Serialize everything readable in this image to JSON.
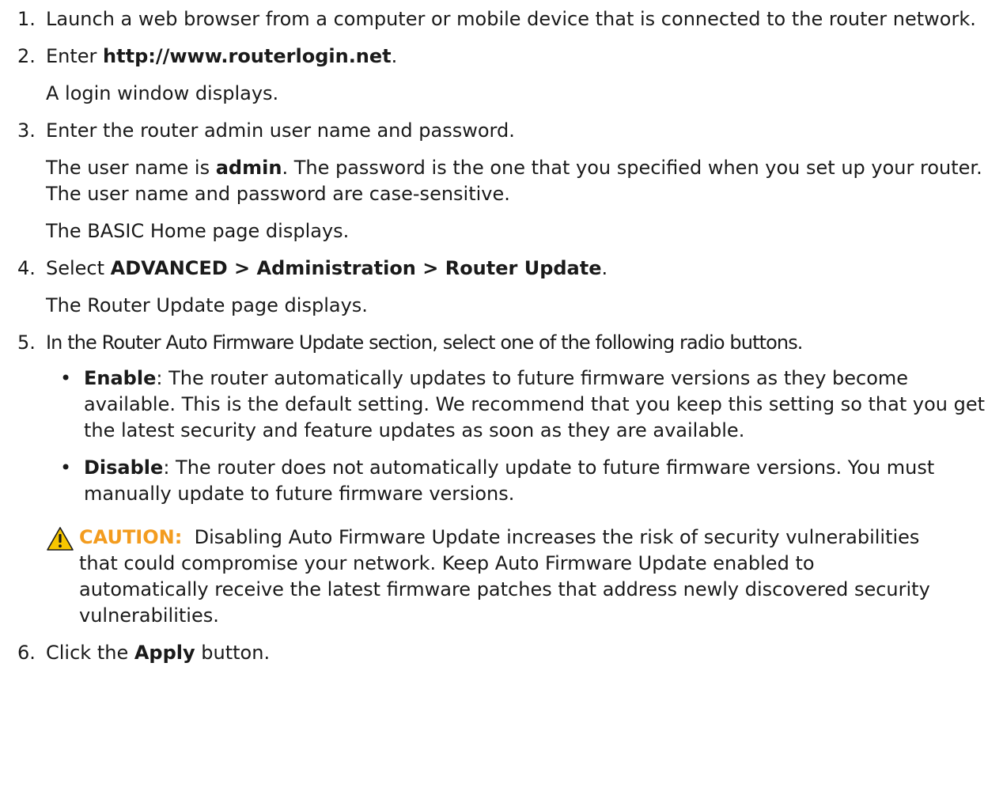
{
  "steps": [
    {
      "num": "1.",
      "lines": [
        {
          "parts": [
            {
              "t": "Launch a web browser from a computer or mobile device that is connected to the router network."
            }
          ]
        }
      ]
    },
    {
      "num": "2.",
      "lines": [
        {
          "parts": [
            {
              "t": "Enter "
            },
            {
              "t": "http://www.routerlogin.net",
              "b": true
            },
            {
              "t": "."
            }
          ]
        },
        {
          "parts": [
            {
              "t": "A login window displays."
            }
          ]
        }
      ]
    },
    {
      "num": "3.",
      "lines": [
        {
          "parts": [
            {
              "t": "Enter the router admin user name and password."
            }
          ]
        },
        {
          "parts": [
            {
              "t": "The user name is "
            },
            {
              "t": "admin",
              "b": true
            },
            {
              "t": ". The password is the one that you specified when you set up your router. The user name and password are case-sensitive."
            }
          ]
        },
        {
          "parts": [
            {
              "t": "The BASIC Home page displays."
            }
          ]
        }
      ]
    },
    {
      "num": "4.",
      "lines": [
        {
          "parts": [
            {
              "t": "Select "
            },
            {
              "t": "ADVANCED > Administration > Router Update",
              "b": true
            },
            {
              "t": "."
            }
          ]
        },
        {
          "parts": [
            {
              "t": "The Router Update page displays."
            }
          ]
        }
      ]
    },
    {
      "num": "5.",
      "lines": [
        {
          "parts": [
            {
              "t": "In the Router Auto Firmware Update section, select one of the following radio buttons."
            }
          ],
          "narrow": true
        }
      ],
      "bullets": [
        {
          "parts": [
            {
              "t": "Enable",
              "b": true
            },
            {
              "t": ": The router automatically updates to future firmware versions as they become available. This is the default setting. We recommend that you keep this setting so that you get the latest security and feature updates as soon as they are available."
            }
          ]
        },
        {
          "parts": [
            {
              "t": "Disable",
              "b": true
            },
            {
              "t": ": The router does not automatically update to future firmware versions. You must manually update to future firmware versions."
            }
          ]
        }
      ],
      "caution": {
        "label": "CAUTION:",
        "text": "  Disabling Auto Firmware Update increases the risk of security vulnerabilities that could compromise your network. Keep Auto Firmware Update enabled to automatically receive the latest firmware patches that address newly discovered security vulnerabilities.",
        "icon": "warning-triangle-icon",
        "label_color": "#f39c1f",
        "icon_color": "#f7c600"
      }
    },
    {
      "num": "6.",
      "lines": [
        {
          "parts": [
            {
              "t": "Click the "
            },
            {
              "t": "Apply",
              "b": true
            },
            {
              "t": " button."
            }
          ]
        }
      ]
    }
  ]
}
